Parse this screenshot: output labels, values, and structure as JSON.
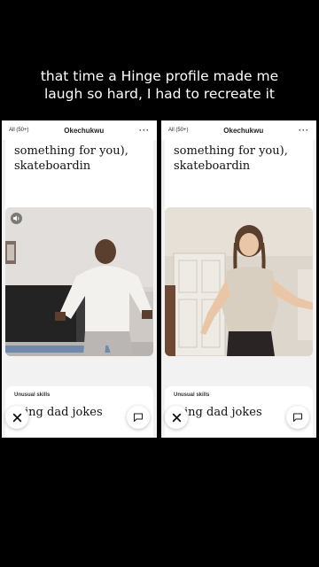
{
  "caption": {
    "line1": "that time a Hinge profile made me",
    "line2": "laugh so hard, I had to recreate it"
  },
  "panels": [
    {
      "filter": "All (50+)",
      "name": "Okechukwu",
      "more": "···",
      "prompt_line1": "something for you),",
      "prompt_line2": "skateboardin",
      "skill_label": "Unusual skills",
      "skill_text": "·king dad jokes"
    },
    {
      "filter": "All (50+)",
      "name": "Okechukwu",
      "more": "···",
      "prompt_line1": "something for you),",
      "prompt_line2": "skateboardin",
      "skill_label": "Unusual skills",
      "skill_text": "·king dad jokes"
    }
  ],
  "icons": {
    "close": "close-icon",
    "comment": "comment-icon",
    "sound": "speaker-icon"
  },
  "colors": {
    "background": "#000000",
    "card": "#ffffff",
    "panel": "#f2f2f2"
  }
}
